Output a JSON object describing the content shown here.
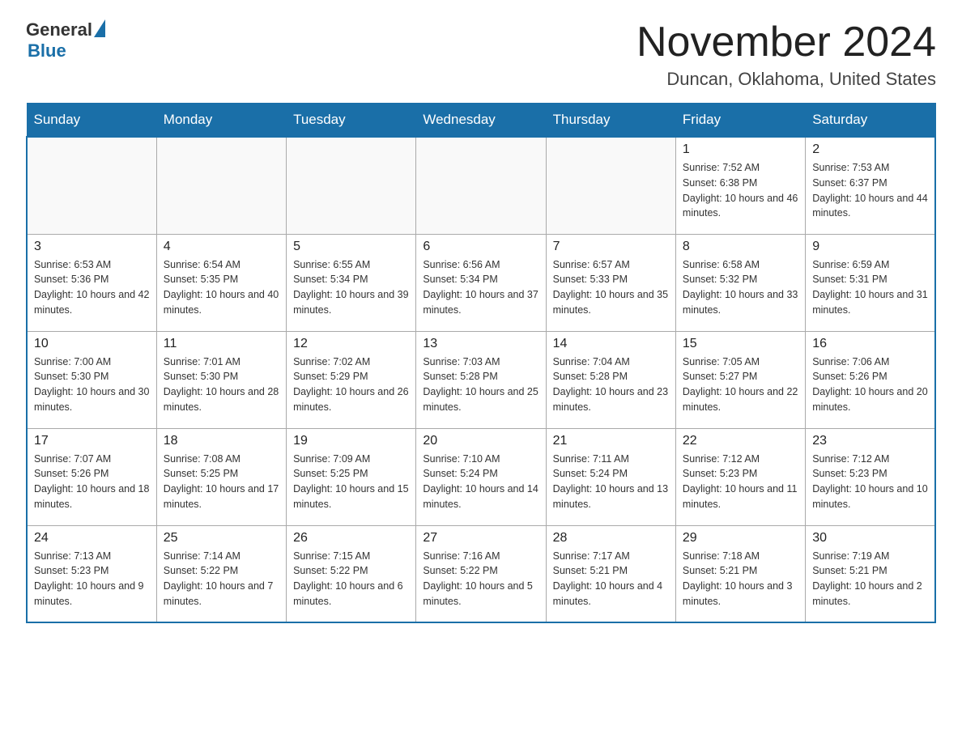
{
  "logo": {
    "general": "General",
    "blue": "Blue"
  },
  "header": {
    "month_year": "November 2024",
    "location": "Duncan, Oklahoma, United States"
  },
  "weekdays": [
    "Sunday",
    "Monday",
    "Tuesday",
    "Wednesday",
    "Thursday",
    "Friday",
    "Saturday"
  ],
  "weeks": [
    [
      {
        "day": "",
        "sunrise": "",
        "sunset": "",
        "daylight": "",
        "empty": true
      },
      {
        "day": "",
        "sunrise": "",
        "sunset": "",
        "daylight": "",
        "empty": true
      },
      {
        "day": "",
        "sunrise": "",
        "sunset": "",
        "daylight": "",
        "empty": true
      },
      {
        "day": "",
        "sunrise": "",
        "sunset": "",
        "daylight": "",
        "empty": true
      },
      {
        "day": "",
        "sunrise": "",
        "sunset": "",
        "daylight": "",
        "empty": true
      },
      {
        "day": "1",
        "sunrise": "Sunrise: 7:52 AM",
        "sunset": "Sunset: 6:38 PM",
        "daylight": "Daylight: 10 hours and 46 minutes.",
        "empty": false
      },
      {
        "day": "2",
        "sunrise": "Sunrise: 7:53 AM",
        "sunset": "Sunset: 6:37 PM",
        "daylight": "Daylight: 10 hours and 44 minutes.",
        "empty": false
      }
    ],
    [
      {
        "day": "3",
        "sunrise": "Sunrise: 6:53 AM",
        "sunset": "Sunset: 5:36 PM",
        "daylight": "Daylight: 10 hours and 42 minutes.",
        "empty": false
      },
      {
        "day": "4",
        "sunrise": "Sunrise: 6:54 AM",
        "sunset": "Sunset: 5:35 PM",
        "daylight": "Daylight: 10 hours and 40 minutes.",
        "empty": false
      },
      {
        "day": "5",
        "sunrise": "Sunrise: 6:55 AM",
        "sunset": "Sunset: 5:34 PM",
        "daylight": "Daylight: 10 hours and 39 minutes.",
        "empty": false
      },
      {
        "day": "6",
        "sunrise": "Sunrise: 6:56 AM",
        "sunset": "Sunset: 5:34 PM",
        "daylight": "Daylight: 10 hours and 37 minutes.",
        "empty": false
      },
      {
        "day": "7",
        "sunrise": "Sunrise: 6:57 AM",
        "sunset": "Sunset: 5:33 PM",
        "daylight": "Daylight: 10 hours and 35 minutes.",
        "empty": false
      },
      {
        "day": "8",
        "sunrise": "Sunrise: 6:58 AM",
        "sunset": "Sunset: 5:32 PM",
        "daylight": "Daylight: 10 hours and 33 minutes.",
        "empty": false
      },
      {
        "day": "9",
        "sunrise": "Sunrise: 6:59 AM",
        "sunset": "Sunset: 5:31 PM",
        "daylight": "Daylight: 10 hours and 31 minutes.",
        "empty": false
      }
    ],
    [
      {
        "day": "10",
        "sunrise": "Sunrise: 7:00 AM",
        "sunset": "Sunset: 5:30 PM",
        "daylight": "Daylight: 10 hours and 30 minutes.",
        "empty": false
      },
      {
        "day": "11",
        "sunrise": "Sunrise: 7:01 AM",
        "sunset": "Sunset: 5:30 PM",
        "daylight": "Daylight: 10 hours and 28 minutes.",
        "empty": false
      },
      {
        "day": "12",
        "sunrise": "Sunrise: 7:02 AM",
        "sunset": "Sunset: 5:29 PM",
        "daylight": "Daylight: 10 hours and 26 minutes.",
        "empty": false
      },
      {
        "day": "13",
        "sunrise": "Sunrise: 7:03 AM",
        "sunset": "Sunset: 5:28 PM",
        "daylight": "Daylight: 10 hours and 25 minutes.",
        "empty": false
      },
      {
        "day": "14",
        "sunrise": "Sunrise: 7:04 AM",
        "sunset": "Sunset: 5:28 PM",
        "daylight": "Daylight: 10 hours and 23 minutes.",
        "empty": false
      },
      {
        "day": "15",
        "sunrise": "Sunrise: 7:05 AM",
        "sunset": "Sunset: 5:27 PM",
        "daylight": "Daylight: 10 hours and 22 minutes.",
        "empty": false
      },
      {
        "day": "16",
        "sunrise": "Sunrise: 7:06 AM",
        "sunset": "Sunset: 5:26 PM",
        "daylight": "Daylight: 10 hours and 20 minutes.",
        "empty": false
      }
    ],
    [
      {
        "day": "17",
        "sunrise": "Sunrise: 7:07 AM",
        "sunset": "Sunset: 5:26 PM",
        "daylight": "Daylight: 10 hours and 18 minutes.",
        "empty": false
      },
      {
        "day": "18",
        "sunrise": "Sunrise: 7:08 AM",
        "sunset": "Sunset: 5:25 PM",
        "daylight": "Daylight: 10 hours and 17 minutes.",
        "empty": false
      },
      {
        "day": "19",
        "sunrise": "Sunrise: 7:09 AM",
        "sunset": "Sunset: 5:25 PM",
        "daylight": "Daylight: 10 hours and 15 minutes.",
        "empty": false
      },
      {
        "day": "20",
        "sunrise": "Sunrise: 7:10 AM",
        "sunset": "Sunset: 5:24 PM",
        "daylight": "Daylight: 10 hours and 14 minutes.",
        "empty": false
      },
      {
        "day": "21",
        "sunrise": "Sunrise: 7:11 AM",
        "sunset": "Sunset: 5:24 PM",
        "daylight": "Daylight: 10 hours and 13 minutes.",
        "empty": false
      },
      {
        "day": "22",
        "sunrise": "Sunrise: 7:12 AM",
        "sunset": "Sunset: 5:23 PM",
        "daylight": "Daylight: 10 hours and 11 minutes.",
        "empty": false
      },
      {
        "day": "23",
        "sunrise": "Sunrise: 7:12 AM",
        "sunset": "Sunset: 5:23 PM",
        "daylight": "Daylight: 10 hours and 10 minutes.",
        "empty": false
      }
    ],
    [
      {
        "day": "24",
        "sunrise": "Sunrise: 7:13 AM",
        "sunset": "Sunset: 5:23 PM",
        "daylight": "Daylight: 10 hours and 9 minutes.",
        "empty": false
      },
      {
        "day": "25",
        "sunrise": "Sunrise: 7:14 AM",
        "sunset": "Sunset: 5:22 PM",
        "daylight": "Daylight: 10 hours and 7 minutes.",
        "empty": false
      },
      {
        "day": "26",
        "sunrise": "Sunrise: 7:15 AM",
        "sunset": "Sunset: 5:22 PM",
        "daylight": "Daylight: 10 hours and 6 minutes.",
        "empty": false
      },
      {
        "day": "27",
        "sunrise": "Sunrise: 7:16 AM",
        "sunset": "Sunset: 5:22 PM",
        "daylight": "Daylight: 10 hours and 5 minutes.",
        "empty": false
      },
      {
        "day": "28",
        "sunrise": "Sunrise: 7:17 AM",
        "sunset": "Sunset: 5:21 PM",
        "daylight": "Daylight: 10 hours and 4 minutes.",
        "empty": false
      },
      {
        "day": "29",
        "sunrise": "Sunrise: 7:18 AM",
        "sunset": "Sunset: 5:21 PM",
        "daylight": "Daylight: 10 hours and 3 minutes.",
        "empty": false
      },
      {
        "day": "30",
        "sunrise": "Sunrise: 7:19 AM",
        "sunset": "Sunset: 5:21 PM",
        "daylight": "Daylight: 10 hours and 2 minutes.",
        "empty": false
      }
    ]
  ]
}
